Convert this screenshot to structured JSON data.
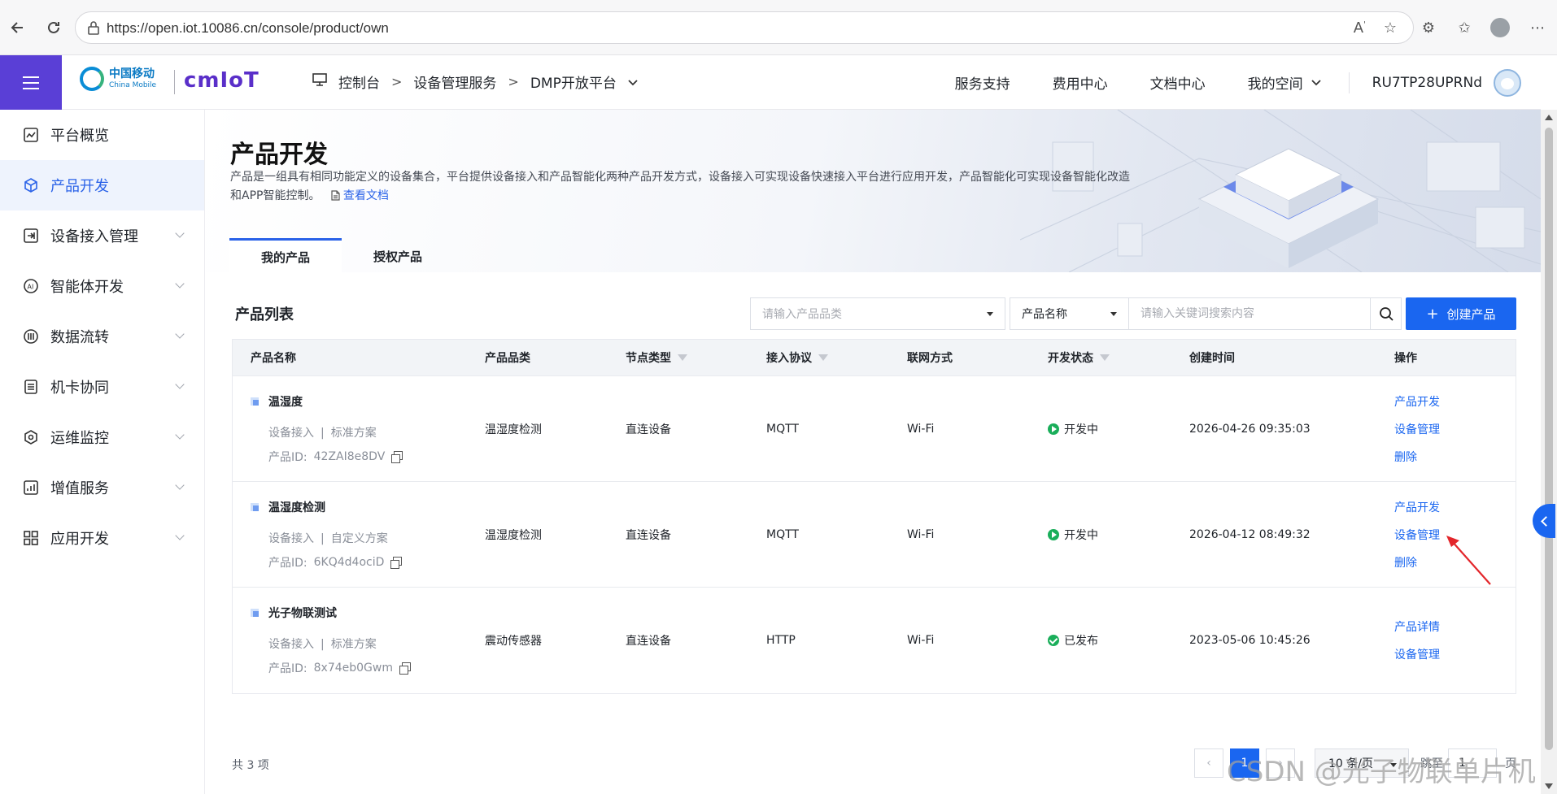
{
  "browser": {
    "url": "https://open.iot.10086.cn/console/product/own"
  },
  "header": {
    "brand_cn": "中国移动",
    "brand_en": "China Mobile",
    "brand_iot": "cmIoT",
    "breadcrumb": [
      "控制台",
      "设备管理服务",
      "DMP开放平台"
    ],
    "nav": [
      "服务支持",
      "费用中心",
      "文档中心",
      "我的空间"
    ],
    "user": "RU7TP28UPRNd"
  },
  "sidebar": {
    "items": [
      {
        "label": "平台概览",
        "icon": "chart-icon"
      },
      {
        "label": "产品开发",
        "icon": "cube-icon"
      },
      {
        "label": "设备接入管理",
        "icon": "device-access-icon"
      },
      {
        "label": "智能体开发",
        "icon": "ai-icon"
      },
      {
        "label": "数据流转",
        "icon": "data-flow-icon"
      },
      {
        "label": "机卡协同",
        "icon": "sim-card-icon"
      },
      {
        "label": "运维监控",
        "icon": "monitor-icon"
      },
      {
        "label": "增值服务",
        "icon": "value-added-icon"
      },
      {
        "label": "应用开发",
        "icon": "apps-icon"
      }
    ]
  },
  "page": {
    "title": "产品开发",
    "description": "产品是一组具有相同功能定义的设备集合，平台提供设备接入和产品智能化两种产品开发方式，设备接入可实现设备快速接入平台进行应用开发，产品智能化可实现设备智能化改造和APP智能控制。",
    "doc_link": "查看文档",
    "tabs": [
      "我的产品",
      "授权产品"
    ]
  },
  "list": {
    "title": "产品列表",
    "category_placeholder": "请输入产品品类",
    "search_field": "产品名称",
    "search_placeholder": "请输入关键词搜索内容",
    "create_label": "创建产品",
    "columns": [
      "产品名称",
      "产品品类",
      "节点类型",
      "接入协议",
      "联网方式",
      "开发状态",
      "创建时间",
      "操作"
    ],
    "rows": [
      {
        "name": "温湿度",
        "access": "设备接入",
        "scheme": "标准方案",
        "id_label": "产品ID:",
        "id": "42ZAI8e8DV",
        "category": "温湿度检测",
        "node": "直连设备",
        "protocol": "MQTT",
        "network": "Wi-Fi",
        "status": "开发中",
        "created": "2026-04-26 09:35:03",
        "ops": [
          "产品开发",
          "设备管理",
          "删除"
        ]
      },
      {
        "name": "温湿度检测",
        "access": "设备接入",
        "scheme": "自定义方案",
        "id_label": "产品ID:",
        "id": "6KQ4d4ociD",
        "category": "温湿度检测",
        "node": "直连设备",
        "protocol": "MQTT",
        "network": "Wi-Fi",
        "status": "开发中",
        "created": "2026-04-12 08:49:32",
        "ops": [
          "产品开发",
          "设备管理",
          "删除"
        ]
      },
      {
        "name": "光子物联测试",
        "access": "设备接入",
        "scheme": "标准方案",
        "id_label": "产品ID:",
        "id": "8x74eb0Gwm",
        "category": "震动传感器",
        "node": "直连设备",
        "protocol": "HTTP",
        "network": "Wi-Fi",
        "status": "已发布",
        "created": "2023-05-06 10:45:26",
        "ops": [
          "产品详情",
          "设备管理"
        ]
      }
    ]
  },
  "pager": {
    "total": "共 3 项",
    "current": "1",
    "page_size": "10 条/页",
    "jump_label": "跳至",
    "jump_value": "1",
    "page_unit": "页"
  },
  "watermark": "CSDN @光子物联单片机",
  "colors": {
    "brand_purple": "#5a3fd6",
    "primary_blue": "#1a66f0",
    "status_green": "#1aae5a",
    "annotation_red": "#e3262b"
  }
}
